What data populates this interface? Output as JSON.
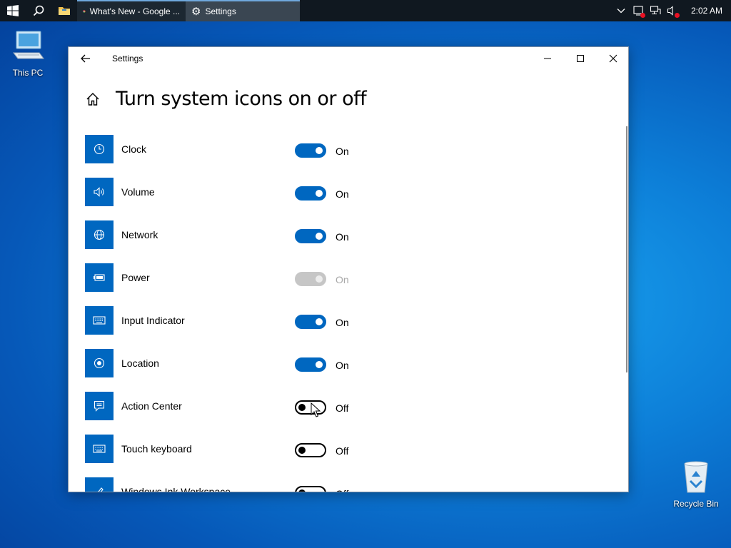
{
  "taskbar": {
    "tasks": [
      {
        "label": "What's New - Google ...",
        "icon": "chrome-icon"
      },
      {
        "label": "Settings",
        "icon": "gear-icon"
      }
    ],
    "clock": "2:02 AM"
  },
  "desktop": {
    "this_pc": "This PC",
    "recycle_bin": "Recycle Bin"
  },
  "window": {
    "title": "Settings",
    "page_title": "Turn system icons on or off",
    "items": [
      {
        "label": "Clock",
        "icon": "clock-icon",
        "state": "On",
        "toggle": "on"
      },
      {
        "label": "Volume",
        "icon": "volume-icon",
        "state": "On",
        "toggle": "on"
      },
      {
        "label": "Network",
        "icon": "globe-icon",
        "state": "On",
        "toggle": "on"
      },
      {
        "label": "Power",
        "icon": "battery-icon",
        "state": "On",
        "toggle": "disabled"
      },
      {
        "label": "Input Indicator",
        "icon": "keyboard-icon",
        "state": "On",
        "toggle": "on"
      },
      {
        "label": "Location",
        "icon": "location-icon",
        "state": "On",
        "toggle": "on"
      },
      {
        "label": "Action Center",
        "icon": "action-center-icon",
        "state": "Off",
        "toggle": "off"
      },
      {
        "label": "Touch keyboard",
        "icon": "keyboard-icon",
        "state": "Off",
        "toggle": "off"
      },
      {
        "label": "Windows Ink Workspace",
        "icon": "pen-icon",
        "state": "Off",
        "toggle": "off"
      }
    ]
  },
  "colors": {
    "accent": "#0067c0",
    "taskbar": "#101820",
    "disabled": "#c6c6c6"
  }
}
